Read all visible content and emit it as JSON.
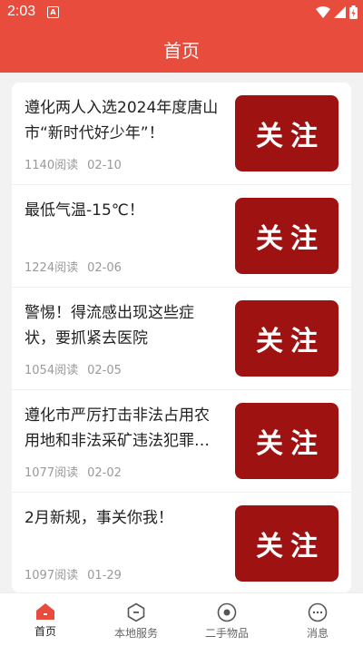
{
  "status_bar": {
    "time": "2:03",
    "notification_badge": "A"
  },
  "header": {
    "title": "首页"
  },
  "articles": [
    {
      "title": "遵化两人入选2024年度唐山市“新时代好少年”！",
      "reads": "1140阅读",
      "date": "02-10",
      "button": "关注"
    },
    {
      "title": "最低气温-15℃！",
      "reads": "1224阅读",
      "date": "02-06",
      "button": "关注"
    },
    {
      "title": "警惕！得流感出现这些症状，要抓紧去医院",
      "reads": "1054阅读",
      "date": "02-05",
      "button": "关注"
    },
    {
      "title": "遵化市严厉打击非法占用农用地和非法采矿违法犯罪行为",
      "reads": "1077阅读",
      "date": "02-02",
      "button": "关注"
    },
    {
      "title": "2月新规，事关你我！",
      "reads": "1097阅读",
      "date": "01-29",
      "button": "关注"
    }
  ],
  "bottom_nav": [
    {
      "label": "首页",
      "icon": "home-icon",
      "active": true
    },
    {
      "label": "本地服务",
      "icon": "service-icon",
      "active": false
    },
    {
      "label": "二手物品",
      "icon": "secondhand-icon",
      "active": false
    },
    {
      "label": "消息",
      "icon": "message-icon",
      "active": false
    }
  ],
  "colors": {
    "header": "#e84c3d",
    "follow_button": "#9e1212",
    "active_tab": "#e84c3d"
  }
}
